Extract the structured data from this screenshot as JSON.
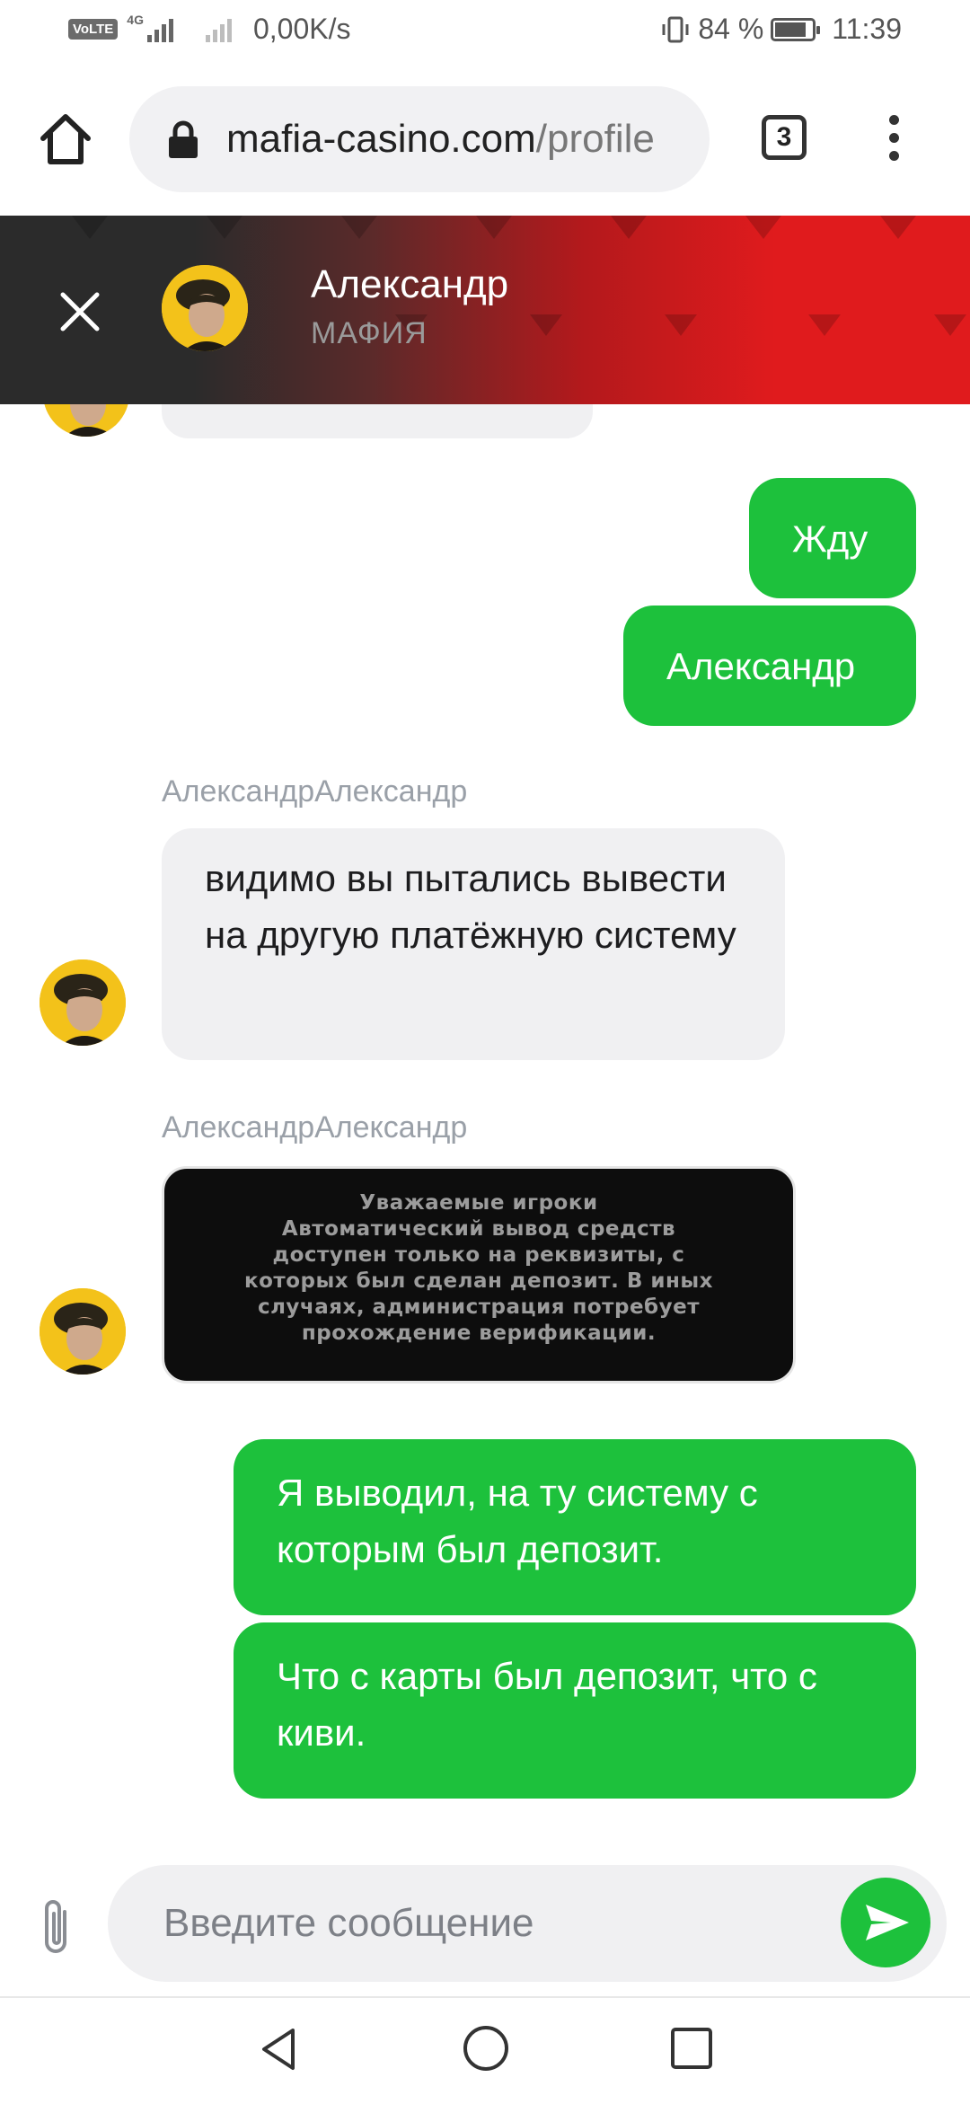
{
  "status_bar": {
    "volte": "VoLTE",
    "network_type": "4G",
    "net_speed": "0,00K/s",
    "battery": "84 %",
    "battery_level": 0.84,
    "time": "11:39"
  },
  "browser": {
    "url_host": "mafia-casino.com",
    "url_path": "/profile",
    "tab_count": "3",
    "icons": [
      "home-icon",
      "lock-icon",
      "tabs-icon",
      "more-vert-icon"
    ]
  },
  "chat_header": {
    "name": "Александр",
    "role": "МАФИЯ",
    "colors": {
      "dark": "#2b2b2b",
      "red": "#e01b1d"
    }
  },
  "messages": [
    {
      "id": "m1",
      "direction": "out",
      "text": "Жду"
    },
    {
      "id": "m2",
      "direction": "out",
      "text": "Александр"
    },
    {
      "id": "m3",
      "direction": "in",
      "sender": "АлександрАлександр",
      "text": "видимо вы пытались вывести на другую платёжную систему"
    },
    {
      "id": "m4",
      "direction": "in",
      "sender": "АлександрАлександр",
      "type": "image",
      "image_text": "Уважаемые игроки\nАвтоматический вывод средств\nдоступен только на реквизиты, с\nкоторых был сделан депозит. В иных\nслучаях, администрация потребует\nпрохождение верификации."
    },
    {
      "id": "m5",
      "direction": "out",
      "text": "Я выводил, на ту систему с которым был депозит."
    },
    {
      "id": "m6",
      "direction": "out",
      "text": "Что с карты был депозит, что с киви."
    }
  ],
  "composer": {
    "placeholder": "Введите сообщение",
    "icons": [
      "paperclip-icon",
      "send-icon"
    ]
  },
  "colors": {
    "accent_green": "#1dc13c",
    "bubble_gray": "#f0f0f2"
  }
}
